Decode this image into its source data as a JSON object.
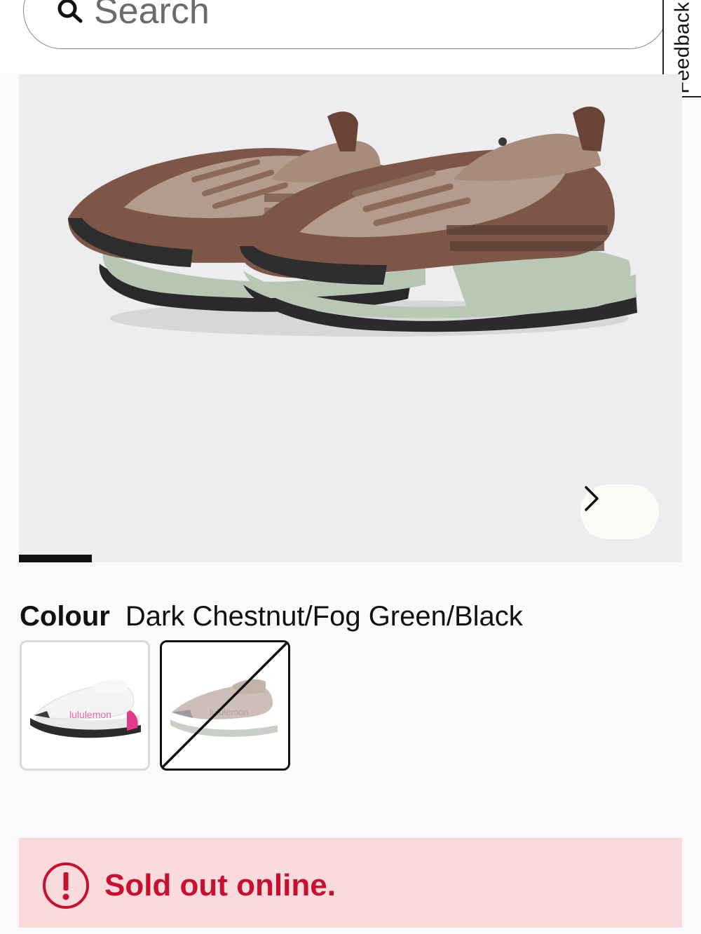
{
  "search": {
    "placeholder": "Search",
    "icon": "search-icon"
  },
  "feedback": {
    "label": "Feedback"
  },
  "gallery": {
    "next_icon": "chevron-right-icon",
    "progress": 0.11,
    "colors": {
      "background": "#ededef",
      "progress": "#111111"
    }
  },
  "colour": {
    "label": "Colour",
    "value": "Dark Chestnut/Fog Green/Black",
    "swatches": [
      {
        "brand_text": "lululemon",
        "sold_out": false,
        "selected": false
      },
      {
        "brand_text": "lululemon",
        "sold_out": true,
        "selected": true
      }
    ]
  },
  "stock": {
    "message": "Sold out online.",
    "icon": "alert-circle-icon",
    "colors": {
      "text": "#c8102e",
      "background": "#fadbdd"
    }
  }
}
